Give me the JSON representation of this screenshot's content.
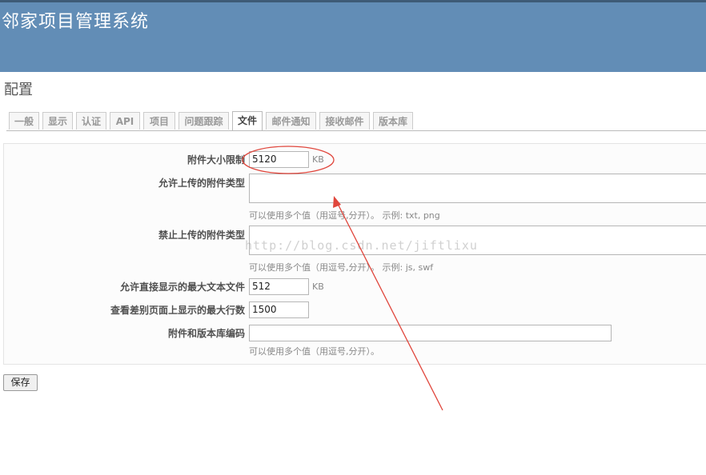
{
  "app": {
    "title": "邻家项目管理系统"
  },
  "page": {
    "title": "配置"
  },
  "tabs": [
    {
      "label": "一般"
    },
    {
      "label": "显示"
    },
    {
      "label": "认证"
    },
    {
      "label": "API"
    },
    {
      "label": "项目"
    },
    {
      "label": "问题跟踪"
    },
    {
      "label": "文件",
      "selected": true
    },
    {
      "label": "邮件通知"
    },
    {
      "label": "接收邮件"
    },
    {
      "label": "版本库"
    }
  ],
  "form": {
    "attachment_max_size": {
      "label": "附件大小限制",
      "value": "5120",
      "unit": "KB"
    },
    "allowed_types": {
      "label": "允许上传的附件类型",
      "value": "",
      "hint": "可以使用多个值（用逗号,分开）。 示例: txt, png"
    },
    "denied_types": {
      "label": "禁止上传的附件类型",
      "value": "",
      "hint": "可以使用多个值（用逗号,分开）。 示例: js, swf"
    },
    "max_display_size": {
      "label": "允许直接显示的最大文本文件",
      "value": "512",
      "unit": "KB"
    },
    "diff_max_lines": {
      "label": "查看差别页面上显示的最大行数",
      "value": "1500"
    },
    "encodings": {
      "label": "附件和版本库编码",
      "value": "",
      "hint": "可以使用多个值（用逗号,分开）。"
    }
  },
  "watermark": "http://blog.csdn.net/jiftlixu",
  "actions": {
    "save_label": "保存"
  },
  "annotation_color": "#e0463c"
}
